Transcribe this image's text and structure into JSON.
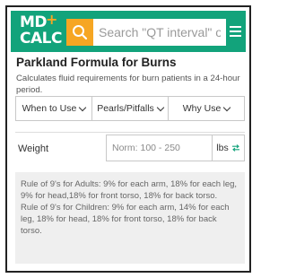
{
  "header": {
    "logo_line1": "MD",
    "logo_plus": "+",
    "logo_line2": "CALC",
    "search_placeholder": "Search \"QT interval\" or",
    "search_icon": "search-icon",
    "menu_icon": "hamburger-menu-icon",
    "brand_color": "#12a37b",
    "accent_color": "#f6a623"
  },
  "calculator": {
    "title": "Parkland Formula for Burns",
    "description": "Calculates fluid requirements for burn patients in a 24-hour period."
  },
  "tabs": [
    {
      "label": "When to Use"
    },
    {
      "label": "Pearls/Pitfalls"
    },
    {
      "label": "Why Use"
    }
  ],
  "weight_field": {
    "label": "Weight",
    "placeholder": "Norm: 100 - 250",
    "unit": "lbs",
    "swap_icon": "swap-arrows-icon"
  },
  "info": {
    "adults": "Rule of 9's for Adults: 9% for each arm, 18% for each leg, 9% for head,18% for front torso, 18% for back torso.",
    "children": "Rule of 9's for Children: 9% for each arm, 14% for each leg, 18% for head, 18% for front torso, 18% for back torso."
  }
}
